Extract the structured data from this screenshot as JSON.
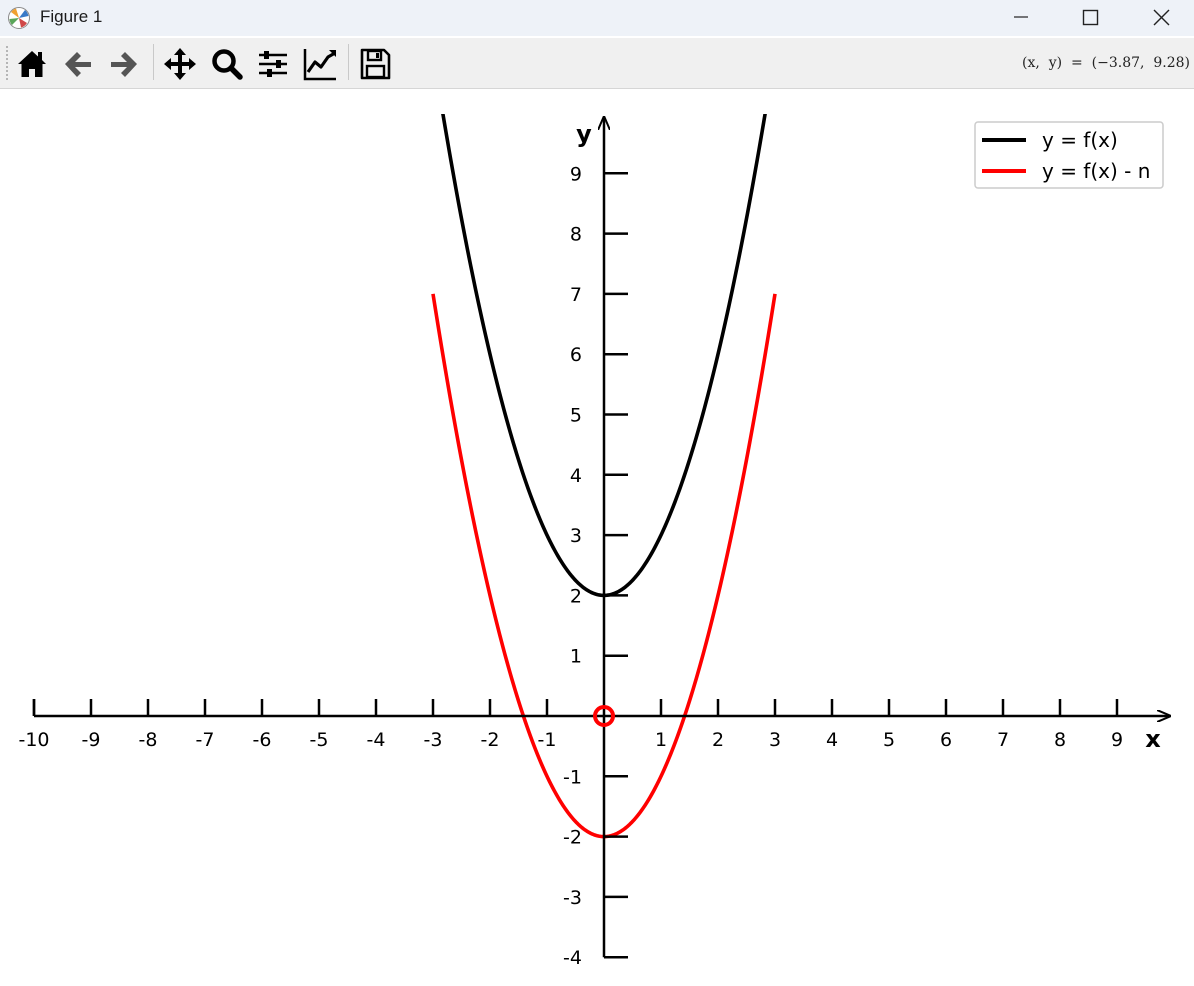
{
  "window": {
    "title": "Figure 1",
    "minimize_icon": "minimize-icon",
    "maximize_icon": "maximize-icon",
    "close_icon": "close-icon"
  },
  "toolbar": {
    "buttons": [
      {
        "name": "home-button",
        "icon": "home-icon"
      },
      {
        "name": "back-button",
        "icon": "arrow-left-icon"
      },
      {
        "name": "forward-button",
        "icon": "arrow-right-icon"
      },
      {
        "name": "pan-button",
        "icon": "move-arrows-icon"
      },
      {
        "name": "zoom-button",
        "icon": "magnifier-icon"
      },
      {
        "name": "configure-subplots-button",
        "icon": "sliders-icon"
      },
      {
        "name": "edit-axis-button",
        "icon": "line-chart-icon"
      },
      {
        "name": "save-button",
        "icon": "floppy-disk-icon"
      }
    ],
    "coordinates": "(x,  y)  =  (−3.87,  9.28)"
  },
  "colors": {
    "series_1": "#000000",
    "series_2": "#ff0000",
    "marker": "#ff0000"
  },
  "chart_data": {
    "type": "line",
    "title": "",
    "xlabel": "x",
    "ylabel": "y",
    "xlim": [
      -10,
      10
    ],
    "ylim": [
      -4,
      10
    ],
    "x_ticks": [
      "-10",
      "-9",
      "-8",
      "-7",
      "-6",
      "-5",
      "-4",
      "-3",
      "-2",
      "-1",
      "1",
      "2",
      "3",
      "4",
      "5",
      "6",
      "7",
      "8",
      "9"
    ],
    "y_ticks": [
      "-4",
      "-3",
      "-2",
      "-1",
      "1",
      "2",
      "3",
      "4",
      "5",
      "6",
      "7",
      "8",
      "9"
    ],
    "grid": false,
    "legend_position": "top-right",
    "series": [
      {
        "name": "y = f(x)",
        "color": "#000000",
        "x": [
          -2.89,
          -2.5,
          -2,
          -1.5,
          -1,
          -0.5,
          0,
          0.5,
          1,
          1.5,
          2,
          2.5,
          2.89
        ],
        "y": [
          10.35,
          8.25,
          6.0,
          4.25,
          3.0,
          2.25,
          2.0,
          2.25,
          3.0,
          4.25,
          6.0,
          8.25,
          10.35
        ]
      },
      {
        "name": "y = f(x) - n",
        "color": "#ff0000",
        "x": [
          -3,
          -2.5,
          -2,
          -1.5,
          -1,
          -0.5,
          0,
          0.5,
          1,
          1.5,
          2,
          2.5,
          3
        ],
        "y": [
          7.0,
          4.25,
          2.0,
          0.25,
          -1.0,
          -1.75,
          -2.0,
          -1.75,
          -1.0,
          0.25,
          2.0,
          4.25,
          7.0
        ]
      }
    ],
    "markers": [
      {
        "name": "origin",
        "x": 0,
        "y": 0,
        "style": "open-circle",
        "color": "#ff0000"
      }
    ]
  }
}
